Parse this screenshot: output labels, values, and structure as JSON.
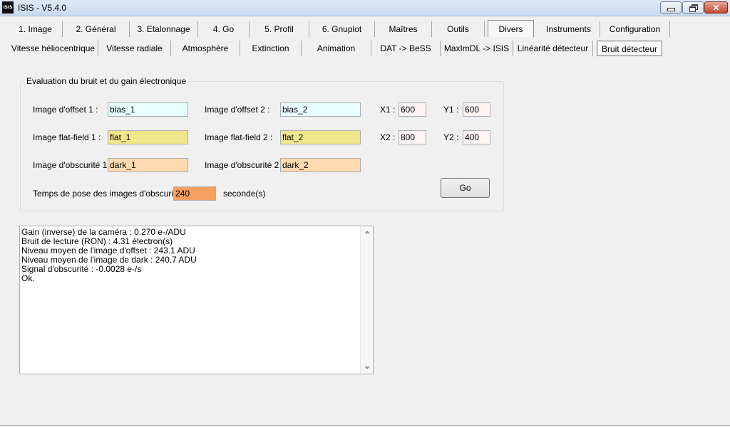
{
  "window": {
    "title": "ISIS - V5.4.0",
    "icon_text": "ISIS",
    "close_glyph": "✕"
  },
  "tabs_main": [
    {
      "label": "1. Image"
    },
    {
      "label": "2. Général"
    },
    {
      "label": "3. Etalonnage"
    },
    {
      "label": "4. Go"
    },
    {
      "label": "5. Profil"
    },
    {
      "label": "6. Gnuplot"
    },
    {
      "label": "Maîtres"
    },
    {
      "label": "Outils"
    },
    {
      "label": "Divers"
    },
    {
      "label": "Instruments"
    },
    {
      "label": "Configuration"
    }
  ],
  "tabs_sub": [
    {
      "label": "Vitesse héliocentrique"
    },
    {
      "label": "Vitesse radiale"
    },
    {
      "label": "Atmosphère"
    },
    {
      "label": "Extinction"
    },
    {
      "label": "Animation"
    },
    {
      "label": "DAT -> BeSS"
    },
    {
      "label": "MaxImDL -> ISIS"
    },
    {
      "label": "Linéarité détecteur"
    },
    {
      "label": "Bruit détecteur"
    }
  ],
  "panel": {
    "title": "Evaluation du bruit et du gain électronique",
    "offset1_label": "Image d'offset 1 :",
    "offset1_value": "bias_1",
    "offset2_label": "Image d'offset 2 :",
    "offset2_value": "bias_2",
    "flat1_label": "Image flat-field 1 :",
    "flat1_value": "flat_1",
    "flat2_label": "Image flat-field 2 :",
    "flat2_value": "flat_2",
    "dark1_label": "Image d'obscurité 1 :",
    "dark1_value": "dark_1",
    "dark2_label": "Image d'obscurité 2 :",
    "dark2_value": "dark_2",
    "x1_label": "X1 :",
    "x1_value": "600",
    "y1_label": "Y1 :",
    "y1_value": "600",
    "x2_label": "X2 :",
    "x2_value": "800",
    "y2_label": "Y2 :",
    "y2_value": "400",
    "exposure_label": "Temps de pose des images d'obscurité :",
    "exposure_value": "240",
    "exposure_unit": "seconde(s)",
    "go_label": "Go"
  },
  "colors": {
    "offset_field": "#e8ffff",
    "flat_field": "#f0e68c",
    "dark_field": "#ffdab0",
    "coord_field": "#fff4f4",
    "exposure_field": "#f4a060"
  },
  "output": {
    "lines": [
      "Gain (inverse) de la caméra : 0.270 e-/ADU",
      "Bruit de lecture (RON) : 4.31 électron(s)",
      "Niveau moyen de l'image d'offset : 243.1 ADU",
      "Niveau moyen de l'image de dark : 240.7 ADU",
      "Signal d'obscurité : -0.0028 e-/s",
      "Ok."
    ]
  }
}
